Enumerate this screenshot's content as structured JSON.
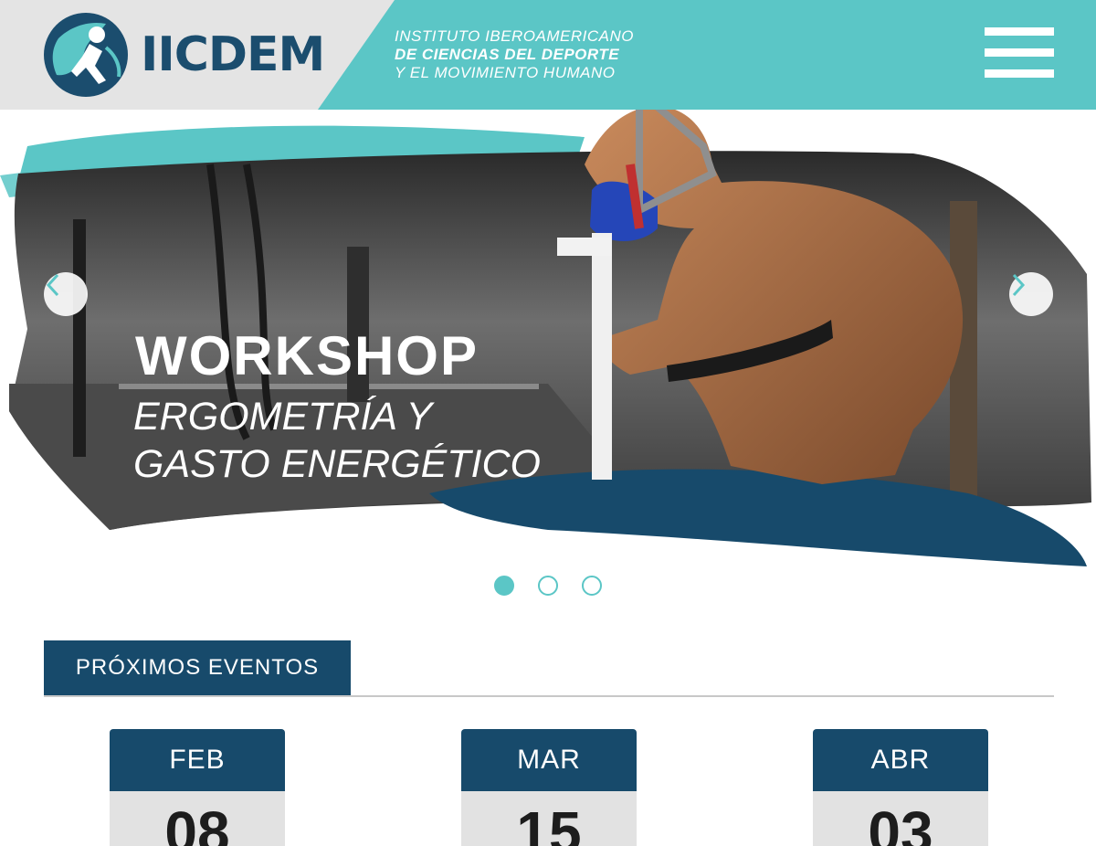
{
  "brand": {
    "logo_text": "IICDEM",
    "tagline": [
      "INSTITUTO IBEROAMERICANO",
      "DE CIENCIAS DEL DEPORTE",
      "Y EL MOVIMIENTO HUMANO"
    ]
  },
  "colors": {
    "teal": "#5bc6c6",
    "navy": "#174a6b",
    "header_grey": "#e4e4e4"
  },
  "nav": {
    "menu_icon": "hamburger-menu-icon"
  },
  "hero": {
    "title": "WORKSHOP",
    "subtitle_lines": [
      "ERGOMETRÍA Y",
      "GASTO ENERGÉTICO"
    ],
    "prev_icon": "chevron-left-icon",
    "next_icon": "chevron-right-icon",
    "slides_total": 3,
    "active_slide": 1
  },
  "events": {
    "heading": "PRÓXIMOS EVENTOS",
    "items": [
      {
        "month": "FEB",
        "day": "08"
      },
      {
        "month": "MAR",
        "day": "15"
      },
      {
        "month": "ABR",
        "day": "03"
      }
    ]
  }
}
